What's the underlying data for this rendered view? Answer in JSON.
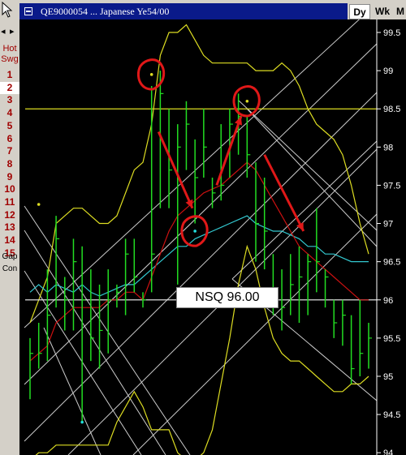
{
  "window": {
    "title": "QE9000054 ... Japanese Ye54/00",
    "timeframes": [
      "Dy",
      "Wk",
      "M"
    ]
  },
  "sidebar": {
    "nav_left": "◂",
    "nav_right": "▸",
    "hot_label": "Hot",
    "swg_label": "Swg",
    "items": [
      "1",
      "2",
      "3",
      "4",
      "5",
      "6",
      "7",
      "8",
      "9",
      "10",
      "11",
      "12",
      "13",
      "14",
      "15"
    ],
    "selected": "2",
    "gap_label": "Gap",
    "con_label": "Con"
  },
  "annotation": {
    "label": "NSQ 96.00"
  },
  "colors": {
    "background": "#000000",
    "bars": "#22dd22",
    "red_average": "#cc1111",
    "cyan_average": "#33c8d0",
    "yellow_band": "#dddd22",
    "gann_lines": "#cccccc",
    "annotation_red": "#e01818",
    "title_bar": "#0a1a8a"
  },
  "chart_data": {
    "type": "ohlc",
    "y_ticks": [
      "99.5",
      "99",
      "98.5",
      "98",
      "97.5",
      "97",
      "96.5",
      "96",
      "95.5",
      "95",
      "94.5",
      "94"
    ],
    "ylim": [
      93.97,
      99.67
    ],
    "x_count": 40,
    "bars": [
      {
        "h": 95.5,
        "l": 94.7,
        "c": 95.3
      },
      {
        "h": 95.7,
        "l": 95.1,
        "c": 95.3
      },
      {
        "h": 96.4,
        "l": 95.2,
        "c": 95.8
      },
      {
        "h": 97.1,
        "l": 95.9,
        "c": 96.8
      },
      {
        "h": 96.3,
        "l": 95.6,
        "c": 96.0
      },
      {
        "h": 96.8,
        "l": 95.6,
        "c": 96.5
      },
      {
        "h": 96.7,
        "l": 94.4,
        "c": 96.0
      },
      {
        "h": 96.4,
        "l": 95.2,
        "c": 95.5
      },
      {
        "h": 96.2,
        "l": 95.1,
        "c": 95.6
      },
      {
        "h": 96.4,
        "l": 95.3,
        "c": 96.0
      },
      {
        "h": 96.2,
        "l": 95.9,
        "c": 96.1
      },
      {
        "h": 96.8,
        "l": 95.8,
        "c": 96.6
      },
      {
        "h": 96.8,
        "l": 96.1,
        "c": 96.3
      },
      {
        "h": 96.1,
        "l": 95.9,
        "c": 96.0
      },
      {
        "h": 98.8,
        "l": 96.1,
        "c": 96.6
      },
      {
        "h": 99.0,
        "l": 97.2,
        "c": 98.7
      },
      {
        "h": 98.5,
        "l": 97.2,
        "c": 97.7
      },
      {
        "h": 98.3,
        "l": 96.2,
        "c": 98.0
      },
      {
        "h": 98.6,
        "l": 97.7,
        "c": 98.3
      },
      {
        "h": 98.1,
        "l": 97.0,
        "c": 97.6
      },
      {
        "h": 98.5,
        "l": 97.6,
        "c": 98.0
      },
      {
        "h": 97.6,
        "l": 97.2,
        "c": 97.4
      },
      {
        "h": 98.3,
        "l": 97.3,
        "c": 97.5
      },
      {
        "h": 98.5,
        "l": 97.6,
        "c": 98.3
      },
      {
        "h": 98.7,
        "l": 97.9,
        "c": 98.4
      },
      {
        "h": 98.4,
        "l": 97.6,
        "c": 97.9
      },
      {
        "h": 97.8,
        "l": 96.5,
        "c": 97.0
      },
      {
        "h": 97.6,
        "l": 96.4,
        "c": 96.9
      },
      {
        "h": 96.6,
        "l": 95.8,
        "c": 96.1
      },
      {
        "h": 96.4,
        "l": 95.6,
        "c": 95.9
      },
      {
        "h": 96.6,
        "l": 95.8,
        "c": 96.2
      },
      {
        "h": 96.7,
        "l": 95.7,
        "c": 96.3
      },
      {
        "h": 96.6,
        "l": 95.8,
        "c": 96.5
      },
      {
        "h": 97.2,
        "l": 96.1,
        "c": 96.5
      },
      {
        "h": 96.4,
        "l": 95.9,
        "c": 96.3
      },
      {
        "h": 96.0,
        "l": 95.5,
        "c": 95.7
      },
      {
        "h": 96.0,
        "l": 95.4,
        "c": 95.8
      },
      {
        "h": 95.8,
        "l": 94.9,
        "c": 95.1
      },
      {
        "h": 96.0,
        "l": 95.0,
        "c": 95.3
      },
      {
        "h": 95.7,
        "l": 95.1,
        "c": 95.5
      }
    ],
    "red_average": [
      95.2,
      95.3,
      95.4,
      95.7,
      95.8,
      95.9,
      95.9,
      95.9,
      95.9,
      96.0,
      96.0,
      96.1,
      96.1,
      96.0,
      96.3,
      96.6,
      96.9,
      97.1,
      97.2,
      97.3,
      97.4,
      97.45,
      97.5,
      97.6,
      97.7,
      97.8,
      97.7,
      97.5,
      97.3,
      97.1,
      96.9,
      96.7,
      96.6,
      96.5,
      96.4,
      96.3,
      96.2,
      96.1,
      96.0,
      96.0
    ],
    "cyan_average": [
      96.1,
      96.2,
      96.1,
      96.2,
      96.15,
      96.1,
      96.2,
      96.1,
      96.05,
      96.1,
      96.15,
      96.2,
      96.2,
      96.3,
      96.4,
      96.5,
      96.6,
      96.7,
      96.7,
      96.8,
      96.85,
      96.9,
      96.95,
      97.0,
      97.05,
      97.1,
      97.0,
      96.95,
      96.9,
      96.9,
      96.85,
      96.8,
      96.7,
      96.7,
      96.6,
      96.6,
      96.55,
      96.5,
      96.5,
      96.5
    ],
    "yellow_upper": [
      95.7,
      96.0,
      96.3,
      97.0,
      97.1,
      97.2,
      97.2,
      97.1,
      97.0,
      97.0,
      97.1,
      97.4,
      97.7,
      97.8,
      98.3,
      99.2,
      99.5,
      99.5,
      99.6,
      99.4,
      99.2,
      99.1,
      99.1,
      99.1,
      99.1,
      99.1,
      99.0,
      99.0,
      99.0,
      99.1,
      99.0,
      98.8,
      98.5,
      98.3,
      98.2,
      98.1,
      97.9,
      97.5,
      97.0,
      96.6
    ],
    "yellow_lower": [
      93.9,
      94.0,
      94.0,
      94.1,
      94.1,
      94.1,
      94.1,
      94.1,
      94.1,
      94.1,
      94.4,
      94.6,
      94.8,
      94.6,
      94.3,
      94.3,
      94.3,
      94.0,
      93.9,
      93.9,
      94.0,
      94.3,
      94.9,
      95.5,
      96.2,
      96.7,
      96.4,
      95.9,
      95.5,
      95.3,
      95.2,
      95.2,
      95.1,
      95.0,
      94.9,
      94.8,
      94.8,
      94.9,
      94.9,
      95.0
    ],
    "horizontal_levels": [
      {
        "value": 98.5,
        "color": "#dddd22"
      },
      {
        "value": 96.0,
        "color": "#dddddd"
      }
    ],
    "highlights": [
      {
        "x": 14,
        "y": 98.95
      },
      {
        "x": 19,
        "y": 96.9
      },
      {
        "x": 25,
        "y": 98.6
      }
    ],
    "markers": [
      {
        "x": 1,
        "y": 97.25,
        "color": "#dddd22"
      },
      {
        "x": 6,
        "y": 94.4,
        "color": "#22dddd"
      },
      {
        "x": 19,
        "y": 96.9,
        "color": "#22dddd"
      },
      {
        "x": 14,
        "y": 98.95,
        "color": "#dddd22"
      },
      {
        "x": 25,
        "y": 98.6,
        "color": "#dddd22"
      }
    ],
    "arrows": [
      {
        "from": [
          14.8,
          98.2
        ],
        "to": [
          18.7,
          97.2
        ]
      },
      {
        "from": [
          21.5,
          97.5
        ],
        "to": [
          24.3,
          98.4
        ]
      },
      {
        "from": [
          27.0,
          97.9
        ],
        "to": [
          31.5,
          96.9
        ]
      }
    ]
  }
}
